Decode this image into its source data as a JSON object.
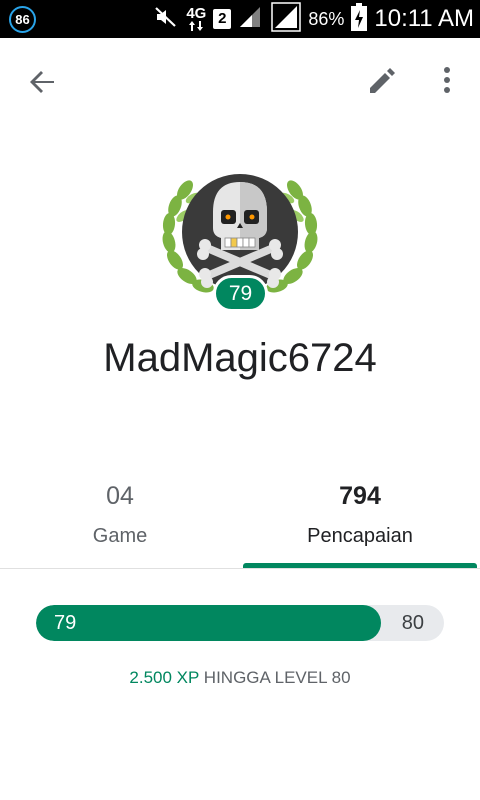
{
  "status_bar": {
    "notification_badge": "86",
    "network_type": "4G",
    "sim_slot": "2",
    "battery_percent": "86%",
    "time": "10:11 AM",
    "icons": [
      "mute-icon",
      "data-arrows-icon",
      "signal-icon",
      "battery-charging-icon"
    ]
  },
  "app_bar": {
    "icons": [
      "back-arrow-icon",
      "pencil-icon",
      "more-vert-icon"
    ]
  },
  "profile": {
    "avatar_icon": "skull-crossbones-laurel-icon",
    "level": "79",
    "username": "MadMagic6724"
  },
  "tabs": [
    {
      "count": "04",
      "label": "Game",
      "selected": false
    },
    {
      "count": "794",
      "label": "Pencapaian",
      "selected": true
    }
  ],
  "progress": {
    "current_level": "79",
    "next_level": "80",
    "fill_fraction": 0.845,
    "xp_amount": "2.500 XP",
    "xp_suffix": " HINGGA LEVEL 80"
  },
  "colors": {
    "accent": "#01875f",
    "track": "#e8eaed",
    "text_primary": "#202124",
    "text_secondary": "#5f6368"
  }
}
